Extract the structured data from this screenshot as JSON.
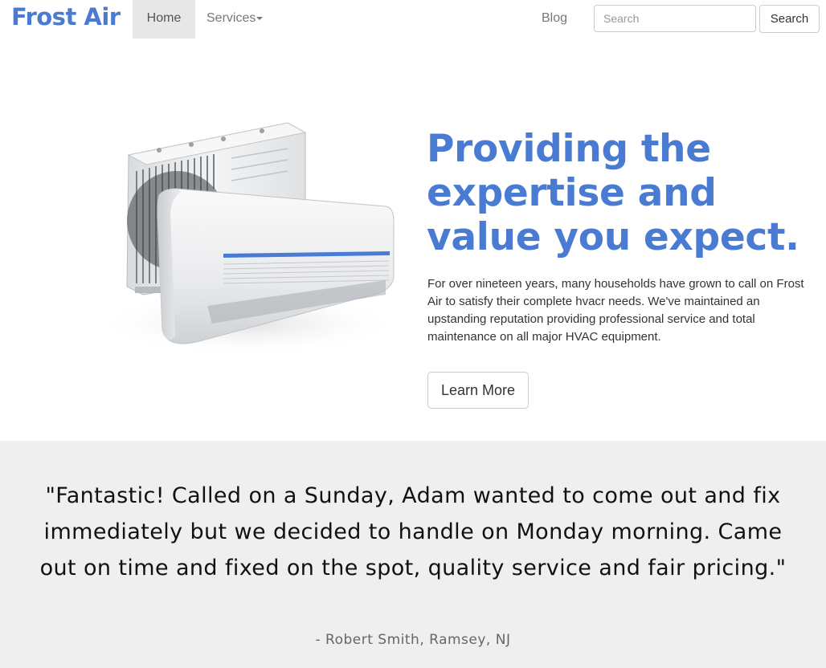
{
  "navbar": {
    "brand": "Frost Air",
    "home_label": "Home",
    "services_label": "Services",
    "blog_label": "Blog",
    "search_placeholder": "Search",
    "search_button_label": "Search"
  },
  "hero": {
    "heading_line1": "Providing the",
    "heading_line2": "expertise and",
    "heading_line3": "value you expect.",
    "body": "For over nineteen years, many households have grown to call on Frost Air to satisfy their complete hvacr needs. We've maintained an upstanding reputation providing professional service and total maintenance on all major HVAC equipment.",
    "cta_label": "Learn More",
    "image": "air-conditioner-units"
  },
  "testimonial": {
    "quote": "\"Fantastic! Called on a Sunday, Adam wanted to come out and fix immediately but we decided to handle on Monday morning. Came out on time and fixed on the spot, quality service and fair pricing.\"",
    "author": "- Robert Smith, Ramsey, NJ"
  },
  "colors": {
    "brand": "#4a7bd2",
    "testimonial_bg": "#efefef",
    "nav_active_bg": "#e7e7e7"
  }
}
